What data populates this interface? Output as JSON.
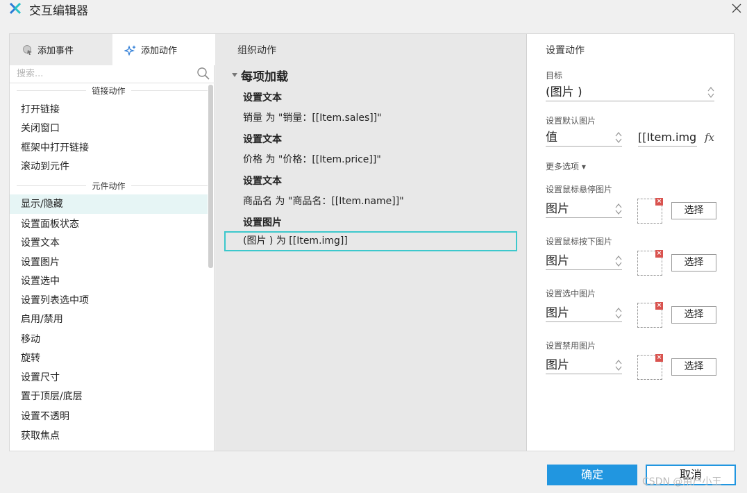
{
  "window": {
    "title": "交互编辑器",
    "close_icon": "close-icon"
  },
  "left": {
    "tabs": [
      {
        "label": "添加事件",
        "icon": "event-icon"
      },
      {
        "label": "添加动作",
        "icon": "sparkle-icon"
      }
    ],
    "search_placeholder": "搜索...",
    "groups": [
      {
        "header": "链接动作",
        "items": [
          "打开链接",
          "关闭窗口",
          "框架中打开链接",
          "滚动到元件"
        ]
      },
      {
        "header": "元件动作",
        "items": [
          "显示/隐藏",
          "设置面板状态",
          "设置文本",
          "设置图片",
          "设置选中",
          "设置列表选中项",
          "启用/禁用",
          "移动",
          "旋转",
          "设置尺寸",
          "置于顶层/底层",
          "设置不透明",
          "获取焦点"
        ]
      }
    ],
    "selected_item": "显示/隐藏"
  },
  "middle": {
    "title": "组织动作",
    "event": "每项加载",
    "actions": [
      {
        "title": "设置文本",
        "desc": "销量 为 \"销量：[[Item.sales]]\""
      },
      {
        "title": "设置文本",
        "desc": "价格 为 \"价格：[[Item.price]]\""
      },
      {
        "title": "设置文本",
        "desc": "商品名 为 \"商品名：[[Item.name]]\""
      },
      {
        "title": "设置图片",
        "desc": "(图片 ) 为 [[Item.img]]"
      }
    ]
  },
  "right": {
    "title": "设置动作",
    "target_label": "目标",
    "target_value": "(图片 )",
    "default_label": "设置默认图片",
    "default_mode": "值",
    "default_value": "[[Item.img]]",
    "fx": "fx",
    "more_options": "更多选项",
    "states": [
      {
        "label": "设置鼠标悬停图片",
        "mode": "图片",
        "button": "选择"
      },
      {
        "label": "设置鼠标按下图片",
        "mode": "图片",
        "button": "选择"
      },
      {
        "label": "设置选中图片",
        "mode": "图片",
        "button": "选择"
      },
      {
        "label": "设置禁用图片",
        "mode": "图片",
        "button": "选择"
      }
    ]
  },
  "footer": {
    "ok": "确定",
    "cancel": "取消",
    "watermark": "CSDN @用户小王"
  },
  "colors": {
    "accent": "#2196e0",
    "selection_outline": "#3cc8cc",
    "selected_row": "#e6f5f5"
  }
}
